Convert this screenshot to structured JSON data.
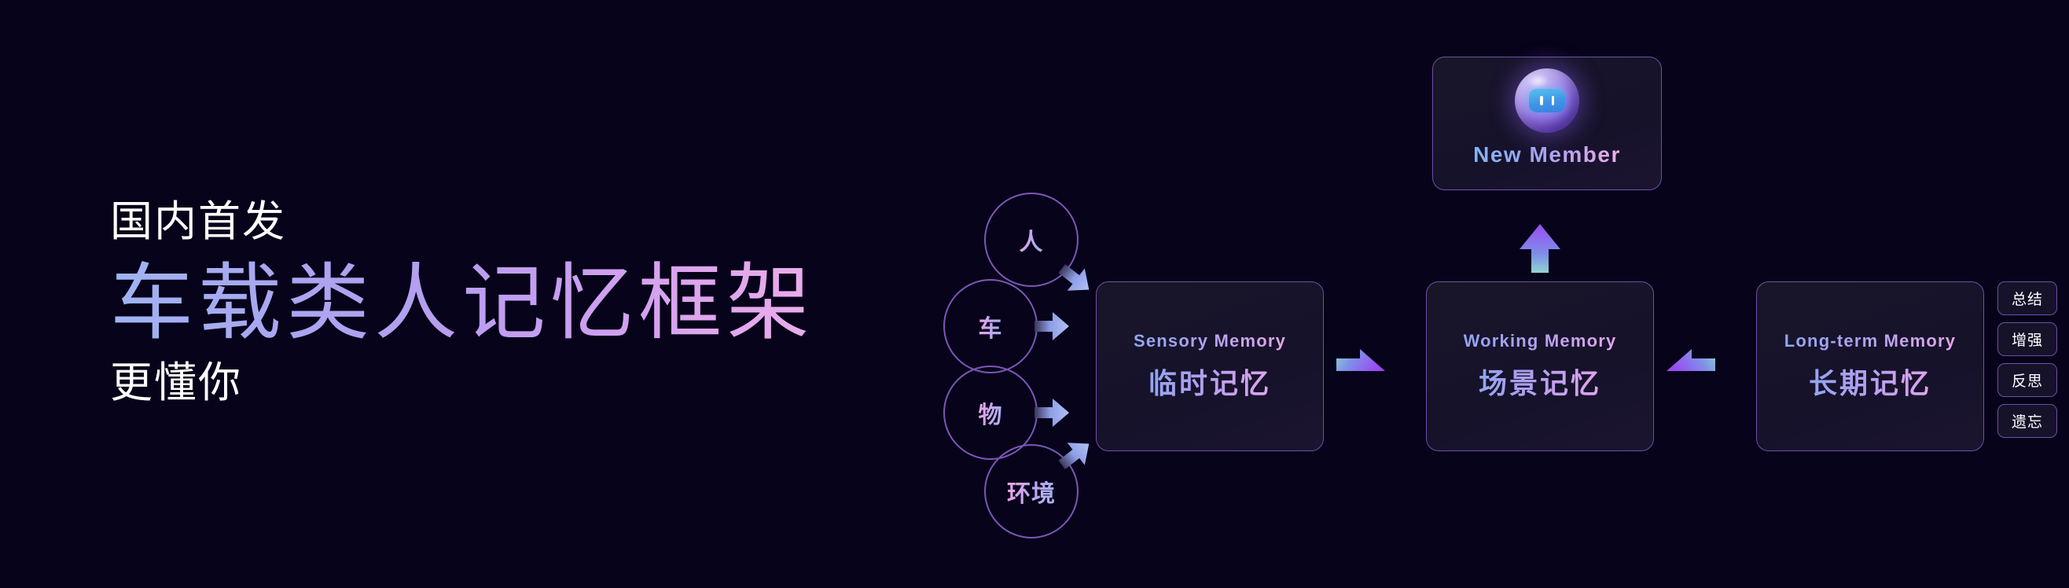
{
  "hero": {
    "eyebrow": "国内首发",
    "title": "车载类人记忆框架",
    "subtitle": "更懂你"
  },
  "colors": {
    "background": "#07031a",
    "card_background": "#16122a",
    "card_border": "#6f4fa6",
    "circle_border": "#7d56b8",
    "gradient_start": "#9fb4f2",
    "gradient_end": "#f0b2ea",
    "arrow_periwinkle": "#9fb0ee",
    "arrow_teal": "#8fd6cf",
    "arrow_purple": "#9b5cf0",
    "orb_purple": "#8f6fe4",
    "orb_face_blue": "#3f96e6",
    "pill_text": "#ffffff"
  },
  "diagram": {
    "input_nodes": [
      {
        "label": "人",
        "arrow": "arrow-down-right-icon"
      },
      {
        "label": "车",
        "arrow": "arrow-right-icon"
      },
      {
        "label": "物",
        "arrow": "arrow-right-icon"
      },
      {
        "label": "环境",
        "arrow": "arrow-up-right-icon"
      }
    ],
    "memory_cards": [
      {
        "en": "Sensory Memory",
        "cn": "临时记忆"
      },
      {
        "en": "Working Memory",
        "cn": "场景记忆"
      },
      {
        "en": "Long-term Memory",
        "cn": "长期记忆"
      }
    ],
    "connectors": [
      {
        "name": "sensory-to-working",
        "direction": "right"
      },
      {
        "name": "longterm-to-working",
        "direction": "left"
      },
      {
        "name": "working-to-new-member",
        "direction": "up"
      }
    ],
    "member_card": {
      "label": "New Member",
      "avatar": "robot-orb-avatar-icon"
    },
    "operations": [
      {
        "label": "总结"
      },
      {
        "label": "增强"
      },
      {
        "label": "反思"
      },
      {
        "label": "遗忘"
      }
    ]
  }
}
